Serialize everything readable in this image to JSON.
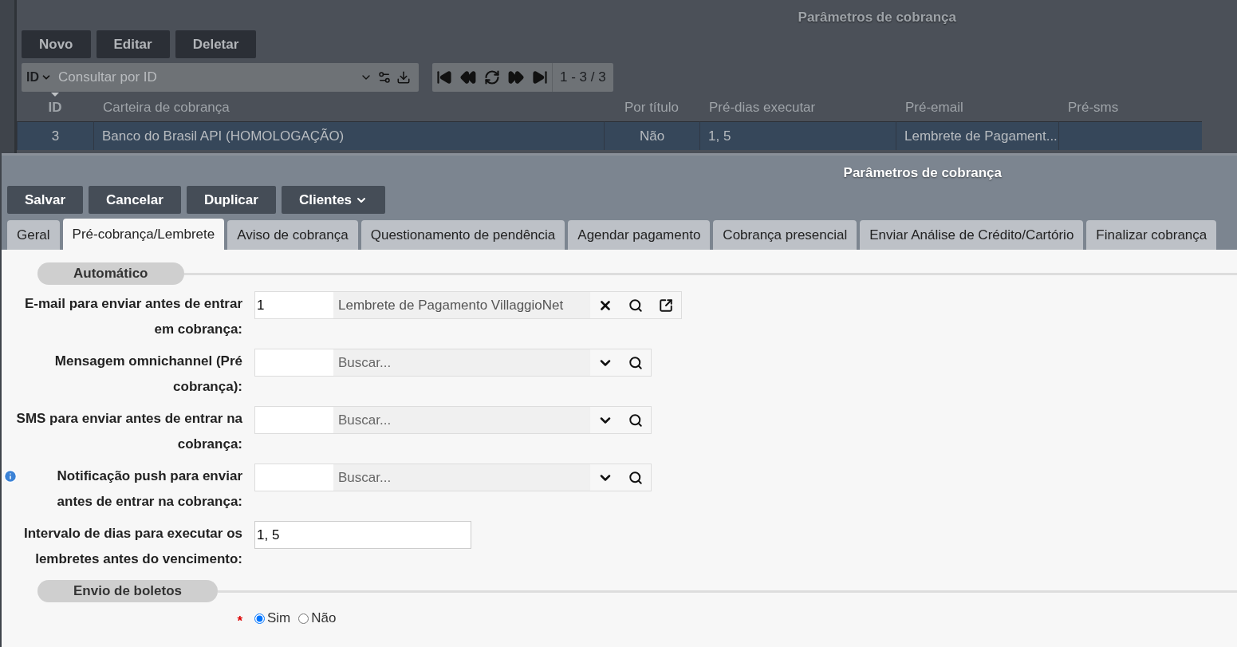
{
  "list_panel": {
    "title": "Parâmetros de cobrança",
    "buttons": [
      "Novo",
      "Editar",
      "Deletar"
    ],
    "search": {
      "field": "ID",
      "placeholder": "Consultar por ID"
    },
    "pager": {
      "range": "1 - 3 / 3"
    },
    "columns": [
      {
        "label": "ID",
        "sorted": true
      },
      {
        "label": "Carteira de cobrança",
        "sorted": false
      },
      {
        "label": "Por título",
        "sorted": false
      },
      {
        "label": "Pré-dias executar",
        "sorted": false
      },
      {
        "label": "Pré-email",
        "sorted": false
      },
      {
        "label": "Pré-sms",
        "sorted": false
      }
    ],
    "rows": [
      {
        "selected": true,
        "cells": [
          "3",
          "Banco do Brasil API (HOMOLOGAÇÃO)",
          "Não",
          "1, 5",
          "Lembrete de Pagament...",
          ""
        ]
      }
    ]
  },
  "form_panel": {
    "title": "Parâmetros de cobrança",
    "buttons": [
      {
        "label": "Salvar",
        "dropdown": false
      },
      {
        "label": "Cancelar",
        "dropdown": false
      },
      {
        "label": "Duplicar",
        "dropdown": false
      },
      {
        "label": "Clientes",
        "dropdown": true
      }
    ],
    "tabs": [
      {
        "label": "Geral",
        "selected": false
      },
      {
        "label": "Pré-cobrança/Lembrete",
        "selected": true
      },
      {
        "label": "Aviso de cobrança",
        "selected": false
      },
      {
        "label": "Questionamento de pendência",
        "selected": false
      },
      {
        "label": "Agendar pagamento",
        "selected": false
      },
      {
        "label": "Cobrança presencial",
        "selected": false
      },
      {
        "label": "Enviar Análise de Crédito/Cartório",
        "selected": false
      },
      {
        "label": "Finalizar cobrança",
        "selected": false
      }
    ],
    "sections": [
      {
        "title": "Automático",
        "fields": [
          {
            "kind": "lookup",
            "label": "E-mail para enviar antes de entrar em cobrança:",
            "info": false,
            "code": "1",
            "description": "Lembrete de Pagamento VillaggioNet",
            "filled": true
          },
          {
            "kind": "lookup",
            "label": "Mensagem omnichannel (Pré cobrança):",
            "info": false,
            "placeholder": "Buscar...",
            "filled": false
          },
          {
            "kind": "lookup",
            "label": "SMS para enviar antes de entrar na cobrança:",
            "info": false,
            "placeholder": "Buscar...",
            "filled": false
          },
          {
            "kind": "lookup",
            "label": "Notificação push para enviar antes de entrar na cobrança:",
            "info": true,
            "placeholder": "Buscar...",
            "filled": false
          },
          {
            "kind": "text",
            "label": "Intervalo de dias para executar os lembretes antes do vencimento:",
            "info": false,
            "value": "1, 5"
          }
        ]
      },
      {
        "title": "Envio de boletos",
        "fields": [
          {
            "kind": "radio",
            "required_mark": "*",
            "options": [
              {
                "label": "Sim",
                "selected": true
              },
              {
                "label": "Não",
                "selected": false
              }
            ]
          }
        ]
      }
    ]
  }
}
